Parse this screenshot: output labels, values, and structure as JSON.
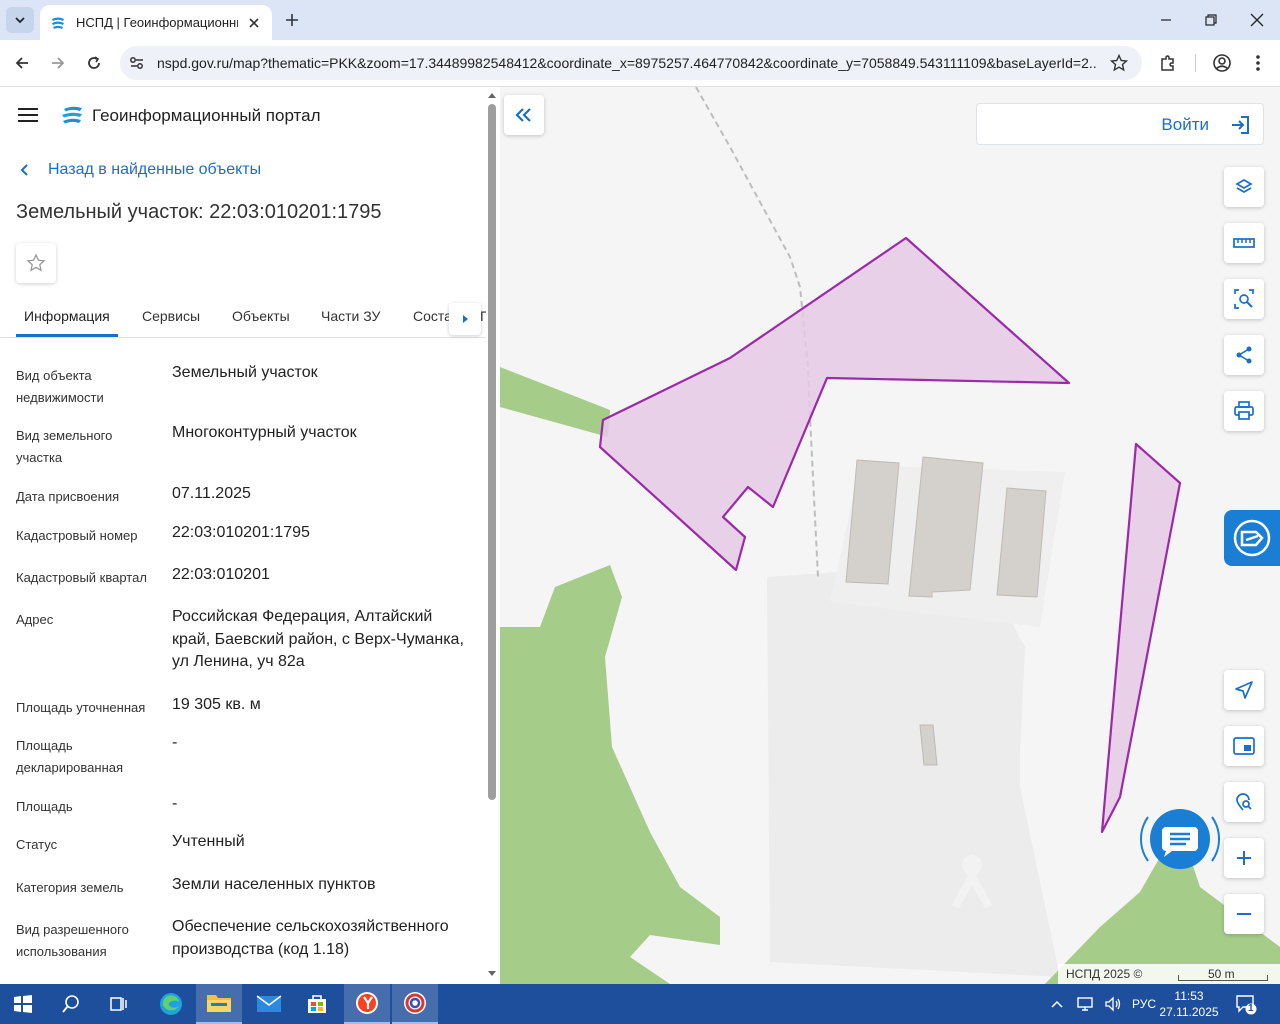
{
  "browser": {
    "tab_title": "НСПД | Геоинформационный",
    "url": "nspd.gov.ru/map?thematic=PKK&zoom=17.34489982548412&coordinate_x=8975257.464770842&coordinate_y=7058849.543111109&baseLayerId=2..."
  },
  "panel": {
    "portal_title": "Геоинформационный портал",
    "back_label": "Назад в найденные объекты",
    "object_title": "Земельный участок: 22:03:010201:1795",
    "tabs": [
      {
        "label": "Информация"
      },
      {
        "label": "Сервисы"
      },
      {
        "label": "Объекты"
      },
      {
        "label": "Части ЗУ"
      },
      {
        "label": "Соста"
      },
      {
        "label": "Г"
      }
    ],
    "attributes": [
      {
        "label": "Вид объекта недвижимости",
        "value": "Земельный участок"
      },
      {
        "label": "Вид земельного участка",
        "value": "Многоконтурный участок"
      },
      {
        "label": "Дата присвоения",
        "value": "07.11.2025"
      },
      {
        "label": "Кадастровый номер",
        "value": "22:03:010201:1795"
      },
      {
        "label": "Кадастровый квартал",
        "value": "22:03:010201"
      },
      {
        "label": "Адрес",
        "value": "Российская Федерация, Алтайский край, Баевский район, с Верх-Чуманка, ул Ленина, уч 82а"
      },
      {
        "label": "Площадь уточненная",
        "value": "19 305 кв. м"
      },
      {
        "label": "Площадь декларированная",
        "value": "-"
      },
      {
        "label": "Площадь",
        "value": "-"
      },
      {
        "label": "Статус",
        "value": "Учтенный"
      },
      {
        "label": "Категория земель",
        "value": "Земли населенных пунктов"
      },
      {
        "label": "Вид разрешенного использования",
        "value": "Обеспечение сельскохозяйственного производства (код 1.18)"
      }
    ]
  },
  "map": {
    "login_label": "Войти",
    "attribution": "НСПД 2025 ©",
    "scale_label": "50 m",
    "colors": {
      "parcel_fill": "#e6c9e6",
      "parcel_stroke": "#9b2aa8",
      "green": "#a5cc89",
      "building": "#d4d0cc",
      "accent": "#1a6fc9"
    }
  },
  "taskbar": {
    "language": "РУС",
    "time": "11:53",
    "date": "27.11.2025",
    "notifications": "1"
  }
}
